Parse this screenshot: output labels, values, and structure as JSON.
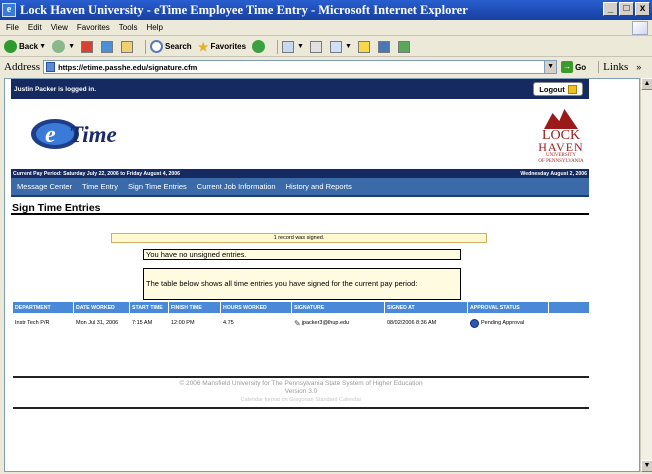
{
  "window": {
    "title": "Lock Haven University - eTime Employee Time Entry - Microsoft Internet Explorer",
    "buttons": [
      "_",
      "□",
      "x"
    ]
  },
  "menu": [
    "File",
    "Edit",
    "View",
    "Favorites",
    "Tools",
    "Help"
  ],
  "toolbar": {
    "back": "Back",
    "search": "Search",
    "favorites": "Favorites"
  },
  "address": {
    "label": "Address",
    "url": "https://etime.passhe.edu/signature.cfm",
    "go": "Go",
    "links": "Links"
  },
  "page": {
    "logged_in": "Justin Packer is logged in.",
    "logout": "Logout",
    "etime_logo": "eTime",
    "univ_logo": {
      "line1": "LOCK",
      "line2": "HAVEN",
      "line3": "UNIVERSITY",
      "line4": "OF PENNSYLVANIA"
    },
    "pay_period": "Current Pay Period: Saturday July 22, 2006 to Friday August 4, 2006",
    "current_date": "Wednesday August 2, 2006",
    "nav": [
      "Message Center",
      "Time Entry",
      "Sign Time Entries",
      "Current Job Information",
      "History and Reports"
    ],
    "section_title": "Sign Time Entries",
    "signed_message": "1 record was signed.",
    "no_unsigned": "You have no unsigned entries.",
    "table_intro": "The table below shows all time entries you have signed for the current pay period:",
    "table": {
      "headers": [
        "DEPARTMENT",
        "DATE WORKED",
        "START TIME",
        "FINISH TIME",
        "HOURS WORKED",
        "SIGNATURE",
        "SIGNED AT",
        "APPROVAL STATUS"
      ],
      "rows": [
        [
          "Instr Tech P/R",
          "Mon Jul 31, 2006",
          "7:15 AM",
          "12:00 PM",
          "4.75",
          "jpacker3@lhup.edu",
          "08/02/2006 8:36 AM",
          "Pending Approval"
        ]
      ]
    },
    "footer": {
      "line1": "© 2006 Mansfield University for The Pennsylvania State System of Higher Education",
      "line2": "Version 3.0",
      "line3": "Calendar format on Gregorian Standard Calendar"
    }
  },
  "colors": {
    "header_navy": "#142a60",
    "nav_blue": "#3a6aa8",
    "table_header": "#4a88d8",
    "univ_red": "#9a1a1a"
  }
}
